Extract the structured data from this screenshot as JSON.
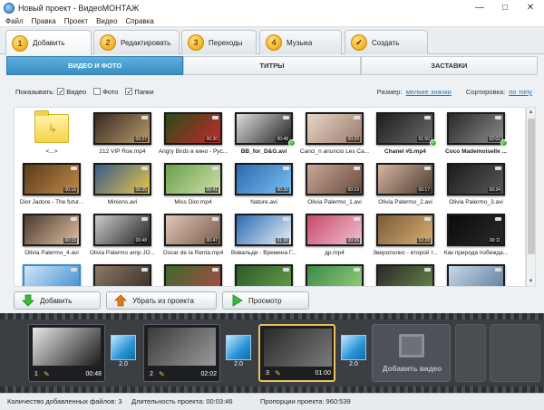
{
  "window": {
    "title": "Новый проект - ВидеоМОНТАЖ",
    "controls": [
      "—",
      "□",
      "✕"
    ]
  },
  "menu": [
    "Файл",
    "Правка",
    "Проект",
    "Видео",
    "Справка"
  ],
  "steps": [
    {
      "num": "1",
      "label": "Добавить",
      "active": true
    },
    {
      "num": "2",
      "label": "Редактировать",
      "active": false
    },
    {
      "num": "3",
      "label": "Переходы",
      "active": false
    },
    {
      "num": "4",
      "label": "Музыка",
      "active": false
    },
    {
      "num": "✔",
      "label": "Создать",
      "active": false
    }
  ],
  "subtabs": [
    {
      "label": "ВИДЕО И ФОТО",
      "active": true
    },
    {
      "label": "ТИТРЫ",
      "active": false
    },
    {
      "label": "ЗАСТАВКИ",
      "active": false
    }
  ],
  "filter": {
    "show_label": "Показывать:",
    "options": [
      {
        "label": "Видео",
        "checked": true
      },
      {
        "label": "Фото",
        "checked": false
      },
      {
        "label": "Папки",
        "checked": true
      }
    ],
    "size_label": "Размер:",
    "size_value": "мелкие значки",
    "sort_label": "Сортировка:",
    "sort_value": "по типу"
  },
  "files": [
    {
      "name": "<...>",
      "folder": true
    },
    {
      "name": "212 VIP Roe.mp4",
      "dur": "00:27",
      "colors": [
        "#3a2a22",
        "#b89a6a"
      ]
    },
    {
      "name": "Angry Birds в кино - Рус...",
      "dur": "00:30",
      "colors": [
        "#2b4b1a",
        "#c22a2a"
      ]
    },
    {
      "name": "BB_for_D&G.avi",
      "dur": "00:48",
      "bold": true,
      "check": true,
      "colors": [
        "#ddd",
        "#222"
      ]
    },
    {
      "name": "Canci_n anuncio Les Ca...",
      "dur": "00:20",
      "colors": [
        "#e8d6c8",
        "#9a7a6a"
      ]
    },
    {
      "name": "Chanel #5.mp4",
      "dur": "01:00",
      "bold": true,
      "check": true,
      "colors": [
        "#1e1e1e",
        "#6a6a6a"
      ]
    },
    {
      "name": "Coco Mademoiselle ...",
      "dur": "02:02",
      "bold": true,
      "check": true,
      "colors": [
        "#2a2a2a",
        "#8a8a8a"
      ]
    },
    {
      "name": "Dior Jadore - The futur...",
      "dur": "00:16",
      "colors": [
        "#5a3a1a",
        "#c08a4a"
      ]
    },
    {
      "name": "Minions.avi",
      "dur": "00:35",
      "colors": [
        "#3a5a8a",
        "#e6c64a"
      ]
    },
    {
      "name": "Miss Dior.mp4",
      "dur": "00:41",
      "colors": [
        "#6aa04a",
        "#cfe0aa"
      ]
    },
    {
      "name": "Nature.avi",
      "dur": "00:30",
      "colors": [
        "#2a6ab0",
        "#7ac0f0"
      ]
    },
    {
      "name": "Olivia Palermo_1.avi",
      "dur": "00:19",
      "colors": [
        "#c8a89a",
        "#6a4a3a"
      ]
    },
    {
      "name": "Olivia Palermo_2.avi",
      "dur": "00:17",
      "colors": [
        "#d6b6a0",
        "#4a3a30"
      ]
    },
    {
      "name": "Olivia Palermo_3.avi",
      "dur": "00:34",
      "colors": [
        "#1a1a1a",
        "#5a5a5a"
      ]
    },
    {
      "name": "Olivia Palermo_4.avi",
      "dur": "00:15",
      "colors": [
        "#4a3a30",
        "#e0c0a0"
      ]
    },
    {
      "name": "Olivia Palermo amp JO...",
      "dur": "00:48",
      "colors": [
        "#cccccc",
        "#222222"
      ]
    },
    {
      "name": "Oscar de la Renta.mp4",
      "dur": "00:47",
      "colors": [
        "#e0c8b8",
        "#7a5a4a"
      ]
    },
    {
      "name": "Вивальди - Времена Г...",
      "dur": "01:30",
      "colors": [
        "#2a6ab0",
        "#e8f0f8"
      ]
    },
    {
      "name": "др.mp4",
      "dur": "00:26",
      "colors": [
        "#c84a6a",
        "#f0c0d0"
      ]
    },
    {
      "name": "Зверополис - второй т...",
      "dur": "02:28",
      "colors": [
        "#7a5a3a",
        "#d8b070"
      ]
    },
    {
      "name": "Как природа побежда...",
      "dur": "00:11",
      "colors": [
        "#0a0a0a",
        "#2a2a2a"
      ]
    },
    {
      "name": "",
      "dur": "",
      "colors": [
        "#d0e6f8",
        "#3a8ad0"
      ]
    },
    {
      "name": "",
      "dur": "",
      "colors": [
        "#8a7a6a",
        "#3a2a20"
      ]
    },
    {
      "name": "",
      "dur": "",
      "colors": [
        "#3a6a2a",
        "#b04a4a"
      ]
    },
    {
      "name": "",
      "dur": "",
      "colors": [
        "#2a5a2a",
        "#6aa04a"
      ]
    },
    {
      "name": "",
      "dur": "",
      "colors": [
        "#3a8a4a",
        "#9ad07a"
      ]
    },
    {
      "name": "",
      "dur": "",
      "colors": [
        "#2a2a2a",
        "#6a8a4a"
      ]
    },
    {
      "name": "",
      "dur": "",
      "colors": [
        "#c8d8e8",
        "#5a7a9a"
      ]
    }
  ],
  "actions": [
    {
      "label": "Добавить",
      "icon": "arrow-down-icon",
      "icon_color": "#3cb73c"
    },
    {
      "label": "Убрать из проекта",
      "icon": "arrow-up-icon",
      "icon_color": "#e07a1a"
    },
    {
      "label": "Просмотр",
      "icon": "play-icon",
      "icon_color": "#3cb73c"
    }
  ],
  "timeline": {
    "clips": [
      {
        "num": "1",
        "dur": "00:48",
        "colors": [
          "#e8e8e8",
          "#1a1a1a"
        ],
        "active": false
      },
      {
        "num": "2",
        "dur": "02:02",
        "colors": [
          "#3a3a3a",
          "#9a9a9a"
        ],
        "active": false
      },
      {
        "num": "3",
        "dur": "01:00",
        "colors": [
          "#2a2a2a",
          "#7a7a7a"
        ],
        "active": true
      }
    ],
    "transitions": [
      "2.0",
      "2.0",
      "2.0"
    ],
    "add_video_label": "Добавить видео"
  },
  "status": {
    "files": "Количество добавленных файлов: 3",
    "duration": "Длительность проекта: 00:03:46",
    "ratio": "Пропорции проекта: 960:539"
  }
}
